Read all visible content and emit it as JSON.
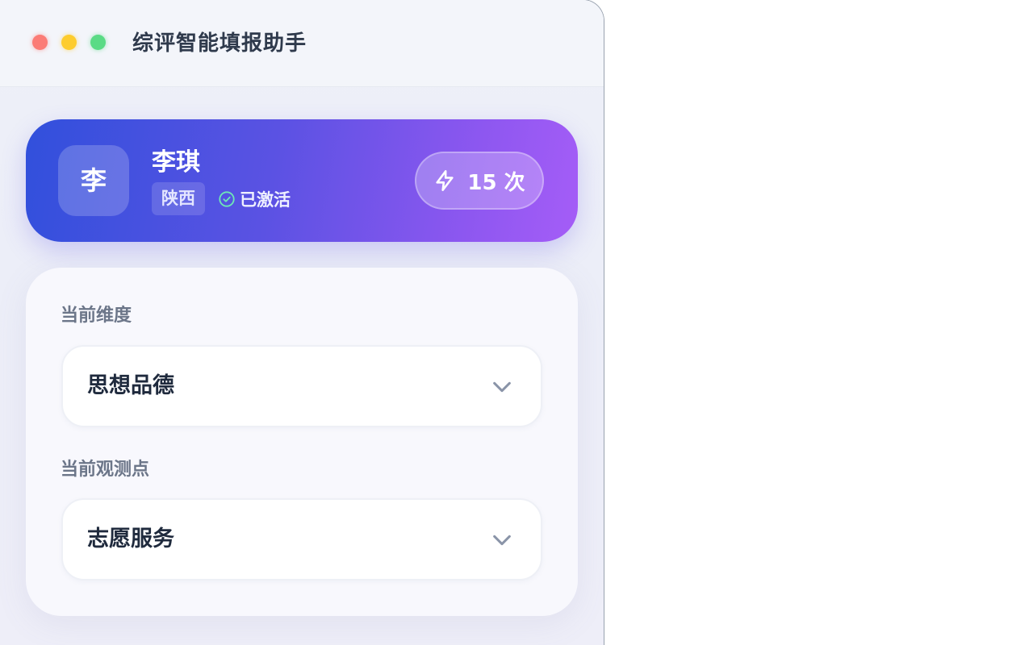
{
  "window": {
    "title": "综评智能填报助手"
  },
  "titlebar_controls": [
    "close",
    "minimize",
    "zoom"
  ],
  "user": {
    "avatar_initial": "李",
    "name": "李琪",
    "province": "陕西",
    "status": "已激活"
  },
  "credits": {
    "label": "15 次",
    "icon": "bolt-icon"
  },
  "form": {
    "dimension": {
      "label": "当前维度",
      "value": "思想品德"
    },
    "observation_point": {
      "label": "当前观测点",
      "value": "志愿服务"
    }
  },
  "colors": {
    "card_gradient_start": "#3150dc",
    "card_gradient_end": "#a55df7",
    "status_check": "#6ee7b7",
    "dot_red": "#fb7c76",
    "dot_yellow": "#fdcc2e",
    "dot_green": "#5adb85"
  }
}
